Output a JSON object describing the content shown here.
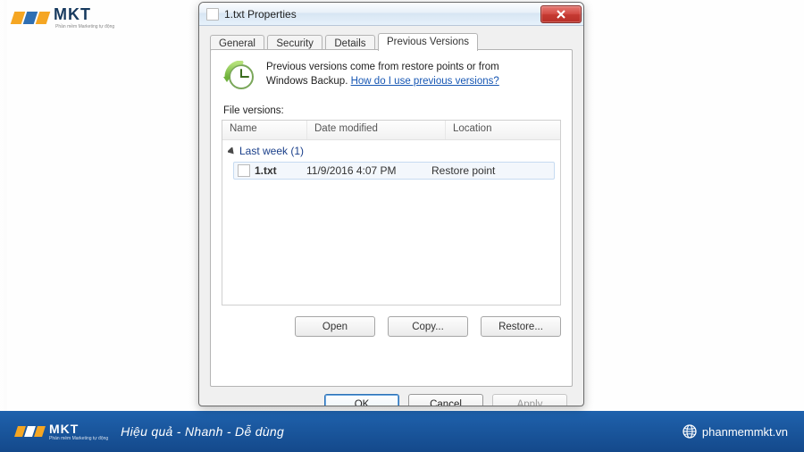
{
  "watermark": {
    "brand": "MKT",
    "tagline_small": "Phần mềm Marketing tự động"
  },
  "dialog": {
    "title": "1.txt Properties",
    "tabs": [
      "General",
      "Security",
      "Details",
      "Previous Versions"
    ],
    "active_tab": 3,
    "intro_line1": "Previous versions come from restore points or from",
    "intro_line2": "Windows Backup. ",
    "intro_link": "How do I use previous versions?",
    "file_versions_label": "File versions:",
    "columns": {
      "name": "Name",
      "date": "Date modified",
      "location": "Location"
    },
    "group_label": "Last week (1)",
    "row": {
      "name": "1.txt",
      "date": "11/9/2016 4:07 PM",
      "location": "Restore point"
    },
    "action_buttons": {
      "open": "Open",
      "copy": "Copy...",
      "restore": "Restore..."
    },
    "footer_buttons": {
      "ok": "OK",
      "cancel": "Cancel",
      "apply": "Apply"
    }
  },
  "footer": {
    "brand": "MKT",
    "tagline": "Hiệu quả - Nhanh  - Dễ dùng",
    "site": "phanmemmkt.vn"
  }
}
